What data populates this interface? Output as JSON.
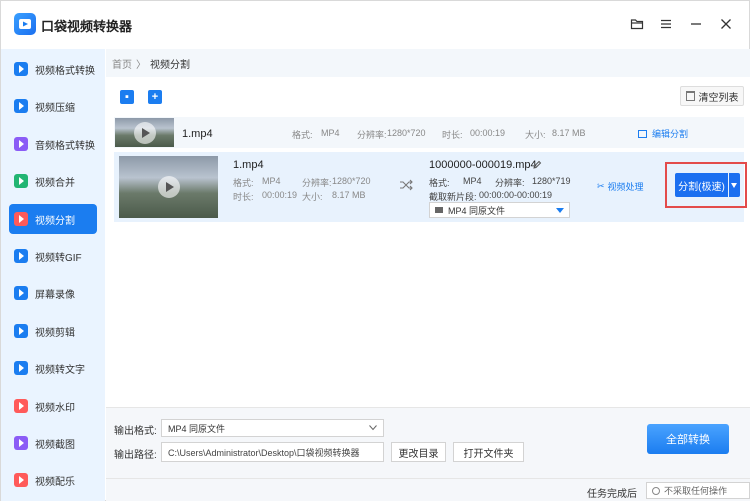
{
  "app": {
    "title": "口袋视频转换器"
  },
  "sidebar": {
    "items": [
      {
        "label": "视频格式转换",
        "color": "#1b7df0",
        "active": false
      },
      {
        "label": "视频压缩",
        "color": "#1b7df0",
        "active": false
      },
      {
        "label": "音频格式转换",
        "color": "#8b5cf6",
        "active": false
      },
      {
        "label": "视频合并",
        "color": "#22b573",
        "active": false
      },
      {
        "label": "视频分割",
        "color": "#ff5a5a",
        "active": true
      },
      {
        "label": "视频转GIF",
        "color": "#1b7df0",
        "active": false
      },
      {
        "label": "屏幕录像",
        "color": "#1b7df0",
        "active": false
      },
      {
        "label": "视频剪辑",
        "color": "#1b7df0",
        "active": false
      },
      {
        "label": "视频转文字",
        "color": "#1b7df0",
        "active": false
      },
      {
        "label": "视频水印",
        "color": "#ff5a5a",
        "active": false
      },
      {
        "label": "视频截图",
        "color": "#8b5cf6",
        "active": false
      },
      {
        "label": "视频配乐",
        "color": "#ff5a5a",
        "active": false
      }
    ]
  },
  "breadcrumb": {
    "home": "首页",
    "sep": "〉",
    "current": "视频分割"
  },
  "toolbar": {
    "clear_label": "清空列表"
  },
  "file1": {
    "name": "1.mp4",
    "format_label": "格式:",
    "format": "MP4",
    "res_label": "分辨率:",
    "res": "1280*720",
    "dur_label": "时长:",
    "dur": "00:00:19",
    "size_label": "大小:",
    "size": "8.17 MB",
    "edit_label": "编辑分割"
  },
  "file2": {
    "name": "1.mp4",
    "format_label": "格式:",
    "format": "MP4",
    "res_label": "分辨率:",
    "res": "1280*720",
    "dur_label": "时长:",
    "dur": "00:00:19",
    "size_label": "大小:",
    "size": "8.17 MB",
    "out_name": "1000000-000019.mp4",
    "out_format_label": "格式:",
    "out_format": "MP4",
    "out_res_label": "分辨率:",
    "out_res": "1280*719",
    "clip_label": "截取新片段:",
    "clip": "00:00:00-00:00:19",
    "out_select": "MP4  同原文件",
    "process_label": "视频处理",
    "split_label": "分割(极速)"
  },
  "bottom": {
    "out_format_label": "输出格式:",
    "out_format_value": "MP4  同原文件",
    "out_path_label": "输出路径:",
    "out_path_value": "C:\\Users\\Administrator\\Desktop\\口袋视频转换器",
    "change_dir": "更改目录",
    "open_folder": "打开文件夹",
    "convert_all": "全部转换",
    "after_label": "任务完成后",
    "after_value": "不采取任何操作"
  }
}
